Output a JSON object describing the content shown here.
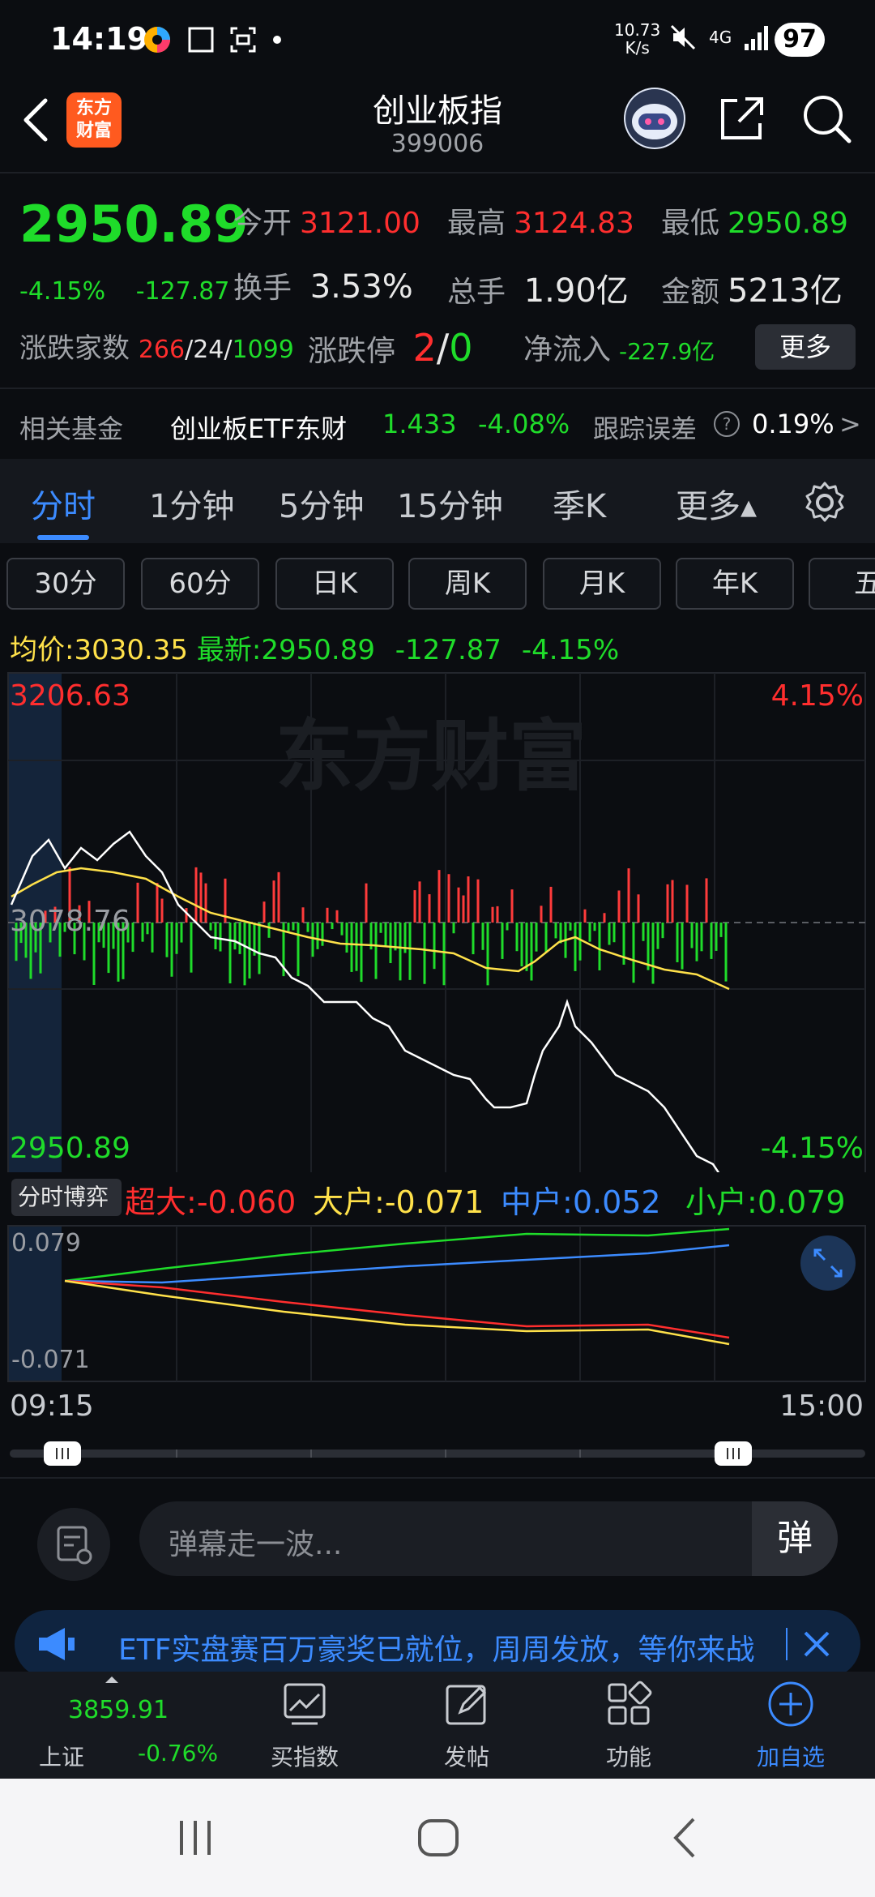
{
  "status_bar": {
    "time": "14:19",
    "net_speed_value": "10.73",
    "net_speed_unit": "K/s",
    "network": "4G",
    "battery": "97"
  },
  "header": {
    "logo_line1": "东方",
    "logo_line2": "财富",
    "title": "创业板指",
    "code": "399006"
  },
  "quote": {
    "price": "2950.89",
    "change_pct": "-4.15%",
    "change_abs": "-127.87",
    "open_label": "今开",
    "open": "3121.00",
    "high_label": "最高",
    "high": "3124.83",
    "low_label": "最低",
    "low": "2950.89",
    "turnover_label": "换手",
    "turnover": "3.53%",
    "volume_label": "总手",
    "volume": "1.90亿",
    "amount_label": "金额",
    "amount": "5213亿",
    "breadth_label": "涨跌家数",
    "breadth_up": "266",
    "breadth_flat": "24",
    "breadth_down": "1099",
    "limit_label": "涨跌停",
    "limit_up": "2",
    "limit_down": "0",
    "netflow_label": "净流入",
    "netflow": "-227.9亿",
    "more_button": "更多"
  },
  "fund": {
    "label": "相关基金",
    "name": "创业板ETF东财",
    "price": "1.433",
    "change": "-4.08%",
    "track_label": "跟踪误差",
    "track_value": "0.19%"
  },
  "tabs": [
    {
      "label": "分时",
      "active": true
    },
    {
      "label": "1分钟"
    },
    {
      "label": "5分钟"
    },
    {
      "label": "15分钟"
    },
    {
      "label": "季K"
    },
    {
      "label": "更多▴"
    }
  ],
  "k_buttons": [
    "30分",
    "60分",
    "日K",
    "周K",
    "月K",
    "年K",
    "五"
  ],
  "avg_line": {
    "avg_label": "均价:",
    "avg_value": "3030.35",
    "latest_label": "最新:",
    "latest_value": "2950.89",
    "change_abs": "-127.87",
    "change_pct": "-4.15%"
  },
  "chart": {
    "watermark": "东方财富",
    "y_top": "3206.63",
    "y_mid": "3078.76",
    "y_bottom": "2950.89",
    "pct_top": "4.15%",
    "pct_bottom": "-4.15%",
    "colors": {
      "price": "#ffffff",
      "avg": "#ffe14a",
      "up": "#ff3b3b",
      "down": "#1fdc2a"
    }
  },
  "flow": {
    "selector": "分时博弈",
    "super_label": "超大:",
    "super_value": "-0.060",
    "large_label": "大户:",
    "large_value": "-0.071",
    "medium_label": "中户:",
    "medium_value": "0.052",
    "small_label": "小户:",
    "small_value": "0.079",
    "y_top": "0.079",
    "y_bottom": "-0.071"
  },
  "time_axis": {
    "start": "09:15",
    "end": "15:00"
  },
  "danmu": {
    "placeholder": "弹幕走一波...",
    "button": "弹"
  },
  "banner": {
    "text": "ETF实盘赛百万豪奖已就位，周周发放，等你来战"
  },
  "bottom_nav": {
    "index_value": "3859.91",
    "index_name": "上证",
    "index_change": "-0.76%",
    "items": [
      {
        "label": "买指数",
        "icon": "chart-icon"
      },
      {
        "label": "发帖",
        "icon": "edit-icon"
      },
      {
        "label": "功能",
        "icon": "grid-icon"
      },
      {
        "label": "加自选",
        "icon": "plus-circle-icon"
      }
    ]
  }
}
